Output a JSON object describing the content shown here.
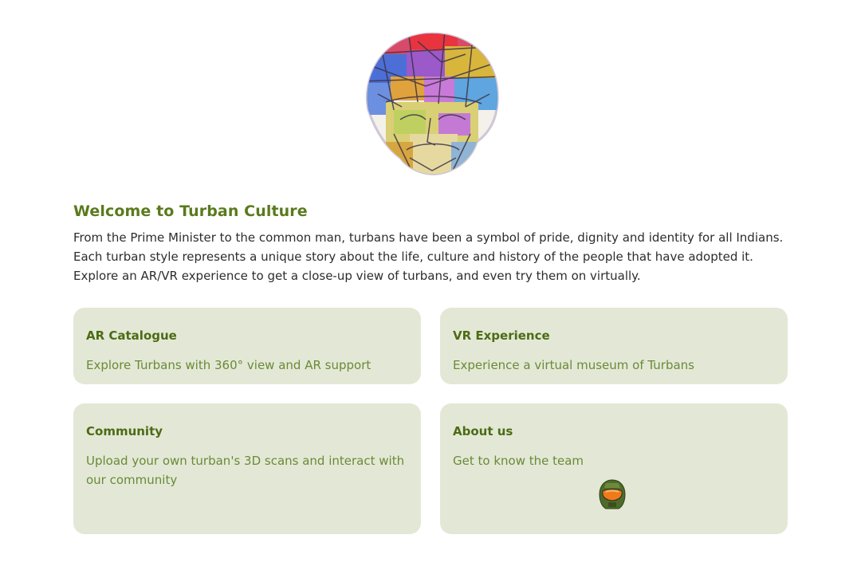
{
  "welcome": {
    "title": "Welcome to Turban Culture",
    "description": "From the Prime Minister to the common man, turbans have been a symbol of pride, dignity and identity for all Indians. Each turban style represents a unique story about the life, culture and history of the people that have adopted it. Explore an AR/VR experience to get a close-up view of turbans, and even try them on virtually."
  },
  "cards": [
    {
      "title": "AR Catalogue",
      "description": "Explore Turbans with 360° view and AR support"
    },
    {
      "title": "VR Experience",
      "description": "Experience a virtual museum of Turbans"
    },
    {
      "title": "Community",
      "description": "Upload your own turban's 3D scans and interact with our community"
    },
    {
      "title": "About us",
      "description": "Get to know the team"
    }
  ],
  "icons": {
    "logo": "turban-logo-icon",
    "team": "helmet-icon"
  },
  "colors": {
    "heading": "#5a7a1e",
    "card_background": "#e3e8d6",
    "card_title": "#4d6b14",
    "card_text": "#6a8a37"
  }
}
